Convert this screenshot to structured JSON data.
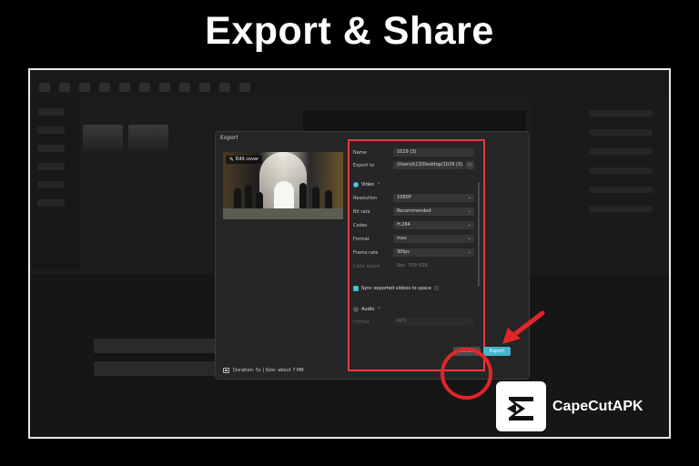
{
  "headline": "Export & Share",
  "dialog": {
    "title": "Export",
    "edit_cover": "Edit cover",
    "footer": "Duration: 5s | Size: about 7 MB",
    "fields": {
      "name_label": "Name",
      "name_value": "1029 (3)",
      "export_to_label": "Export to",
      "export_to_value": "/Users/k13/Desktop/1029 (3).mov",
      "video_label": "Video",
      "resolution_label": "Resolution",
      "resolution_value": "1080P",
      "bitrate_label": "Bit rate",
      "bitrate_value": "Recommended",
      "codec_label": "Codec",
      "codec_value": "H.264",
      "format_label": "Format",
      "format_value": "mov",
      "framerate_label": "Frame rate",
      "framerate_value": "30fps",
      "color_space_label": "Color space",
      "color_space_value": "Rec. 709 SDR",
      "sync_label": "Sync exported videos to space",
      "audio_label": "Audio",
      "audio_format_label": "Format",
      "audio_format_value": "MP3"
    },
    "cancel_label": "Cancel",
    "export_label": "Export"
  },
  "brand": {
    "name": "CapeCutAPK"
  },
  "colors": {
    "highlight": "#e23b3f",
    "accent": "#42b6cf"
  }
}
